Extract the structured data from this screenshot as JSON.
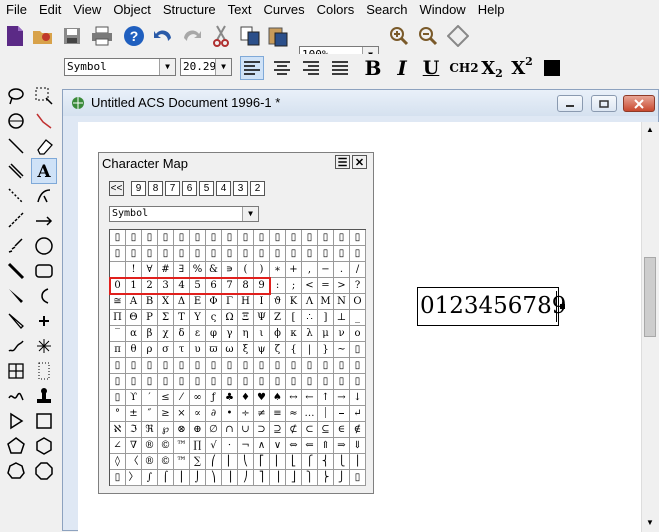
{
  "menu": [
    "File",
    "Edit",
    "View",
    "Object",
    "Structure",
    "Text",
    "Curves",
    "Colors",
    "Search",
    "Window",
    "Help"
  ],
  "toolbar": {
    "zoom": "100%"
  },
  "format_bar": {
    "font": "Symbol",
    "size": "20.29",
    "b": "B",
    "i": "I",
    "u": "U",
    "ch2": "CH2",
    "sub": "X",
    "sub2": "2",
    "sup": "X",
    "sup2": "2"
  },
  "doc": {
    "title": "Untitled ACS Document 1996-1 *"
  },
  "charmap": {
    "title": "Character Map",
    "prev": "<<",
    "pages": [
      "9",
      "8",
      "7",
      "6",
      "5",
      "4",
      "3",
      "2"
    ],
    "font": "Symbol",
    "rows": [
      [
        "▯",
        "▯",
        "▯",
        "▯",
        "▯",
        "▯",
        "▯",
        "▯",
        "▯",
        "▯",
        "▯",
        "▯",
        "▯",
        "▯",
        "▯",
        "▯"
      ],
      [
        "▯",
        "▯",
        "▯",
        "▯",
        "▯",
        "▯",
        "▯",
        "▯",
        "▯",
        "▯",
        "▯",
        "▯",
        "▯",
        "▯",
        "▯",
        "▯"
      ],
      [
        " ",
        "!",
        "∀",
        "#",
        "∃",
        "%",
        "&",
        "∍",
        "(",
        ")",
        "∗",
        "+",
        ",",
        "−",
        ".",
        "/"
      ],
      [
        "0",
        "1",
        "2",
        "3",
        "4",
        "5",
        "6",
        "7",
        "8",
        "9",
        ":",
        ";",
        "<",
        "=",
        ">",
        "?"
      ],
      [
        "≅",
        "Α",
        "Β",
        "Χ",
        "Δ",
        "Ε",
        "Φ",
        "Γ",
        "Η",
        "Ι",
        "ϑ",
        "Κ",
        "Λ",
        "Μ",
        "Ν",
        "Ο"
      ],
      [
        "Π",
        "Θ",
        "Ρ",
        "Σ",
        "Τ",
        "Υ",
        "ς",
        "Ω",
        "Ξ",
        "Ψ",
        "Ζ",
        "[",
        "∴",
        "]",
        "⊥",
        "_"
      ],
      [
        "‾",
        "α",
        "β",
        "χ",
        "δ",
        "ε",
        "φ",
        "γ",
        "η",
        "ι",
        "ϕ",
        "κ",
        "λ",
        "μ",
        "ν",
        "ο"
      ],
      [
        "π",
        "θ",
        "ρ",
        "σ",
        "τ",
        "υ",
        "ϖ",
        "ω",
        "ξ",
        "ψ",
        "ζ",
        "{",
        "|",
        "}",
        "∼",
        "▯"
      ],
      [
        "▯",
        "▯",
        "▯",
        "▯",
        "▯",
        "▯",
        "▯",
        "▯",
        "▯",
        "▯",
        "▯",
        "▯",
        "▯",
        "▯",
        "▯",
        "▯"
      ],
      [
        "▯",
        "▯",
        "▯",
        "▯",
        "▯",
        "▯",
        "▯",
        "▯",
        "▯",
        "▯",
        "▯",
        "▯",
        "▯",
        "▯",
        "▯",
        "▯"
      ],
      [
        "▯",
        "ϒ",
        "′",
        "≤",
        "⁄",
        "∞",
        "ƒ",
        "♣",
        "♦",
        "♥",
        "♠",
        "↔",
        "←",
        "↑",
        "→",
        "↓"
      ],
      [
        "°",
        "±",
        "″",
        "≥",
        "×",
        "∝",
        "∂",
        "•",
        "÷",
        "≠",
        "≡",
        "≈",
        "…",
        "⏐",
        "⎯",
        "↵"
      ],
      [
        "ℵ",
        "ℑ",
        "ℜ",
        "℘",
        "⊗",
        "⊕",
        "∅",
        "∩",
        "∪",
        "⊃",
        "⊇",
        "⊄",
        "⊂",
        "⊆",
        "∈",
        "∉"
      ],
      [
        "∠",
        "∇",
        "®",
        "©",
        "™",
        "∏",
        "√",
        "⋅",
        "¬",
        "∧",
        "∨",
        "⇔",
        "⇐",
        "⇑",
        "⇒",
        "⇓"
      ],
      [
        "◊",
        "〈",
        "®",
        "©",
        "™",
        "∑",
        "⎛",
        "⎜",
        "⎝",
        "⎡",
        "⎢",
        "⎣",
        "⎧",
        "⎨",
        "⎩",
        "⎪"
      ],
      [
        "▯",
        "〉",
        "∫",
        "⌠",
        "⎮",
        "⌡",
        "⎞",
        "⎟",
        "⎠",
        "⎤",
        "⎥",
        "⎦",
        "⎫",
        "⎬",
        "⎭",
        "▯"
      ]
    ]
  },
  "canvas": {
    "text": "0123456789"
  }
}
